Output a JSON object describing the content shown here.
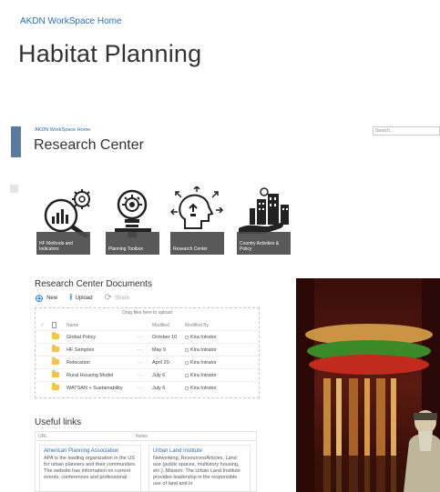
{
  "header": {
    "breadcrumb": "AKDN WorkSpace Home",
    "title": "Habitat Planning"
  },
  "subsite": {
    "breadcrumb": "AKDN WorkSpace Home",
    "title": "Research Center",
    "search_placeholder": "Search..."
  },
  "tiles": [
    {
      "label": "HF Methods and Indicators",
      "icon": "chart-gear-icon"
    },
    {
      "label": "Planning Toolbox",
      "icon": "lightbulb-gear-icon"
    },
    {
      "label": "Research Center",
      "icon": "head-arrows-icon"
    },
    {
      "label": "Country Activities & Policy",
      "icon": "city-hand-icon"
    }
  ],
  "documents": {
    "title": "Research Center Documents",
    "toolbar": {
      "new": "New",
      "upload": "Upload",
      "share": "Share"
    },
    "drop_hint": "Drag files here to upload",
    "columns": {
      "name": "Name",
      "modified": "Modified",
      "modified_by": "Modified By"
    },
    "rows": [
      {
        "name": "Global Policy",
        "modified": "October 10",
        "modified_by": "Kira Intrator"
      },
      {
        "name": "HF Samples",
        "modified": "May 9",
        "modified_by": "Kira Intrator"
      },
      {
        "name": "Relocation",
        "modified": "April 20",
        "modified_by": "Kira Intrator"
      },
      {
        "name": "Rural Housing Model",
        "modified": "July 6",
        "modified_by": "Kira Intrator"
      },
      {
        "name": "WATSAN + Sustainability",
        "modified": "July 6",
        "modified_by": "Kira Intrator"
      }
    ],
    "ellipsis": "..."
  },
  "useful_links": {
    "title": "Useful links",
    "columns": {
      "url": "URL",
      "notes": "Notes"
    },
    "items": [
      {
        "title": "American Planning Association",
        "description": "APA is the leading organization in the US for urban planners and their communities. The website has information on current events, conferences and professional"
      },
      {
        "title": "Urban Land Institute",
        "description": "Networking, Resources/Articles, Land use (public spaces, multistory housing, etc.). Mission: The Urban Land Institute provides leadership in the responsible use of land and in"
      }
    ]
  },
  "colors": {
    "link": "#2a6fb3",
    "accent_bar": "#5a7aa0",
    "folder": "#f6c34a",
    "tile_label_bg": "#4b4b4b"
  }
}
